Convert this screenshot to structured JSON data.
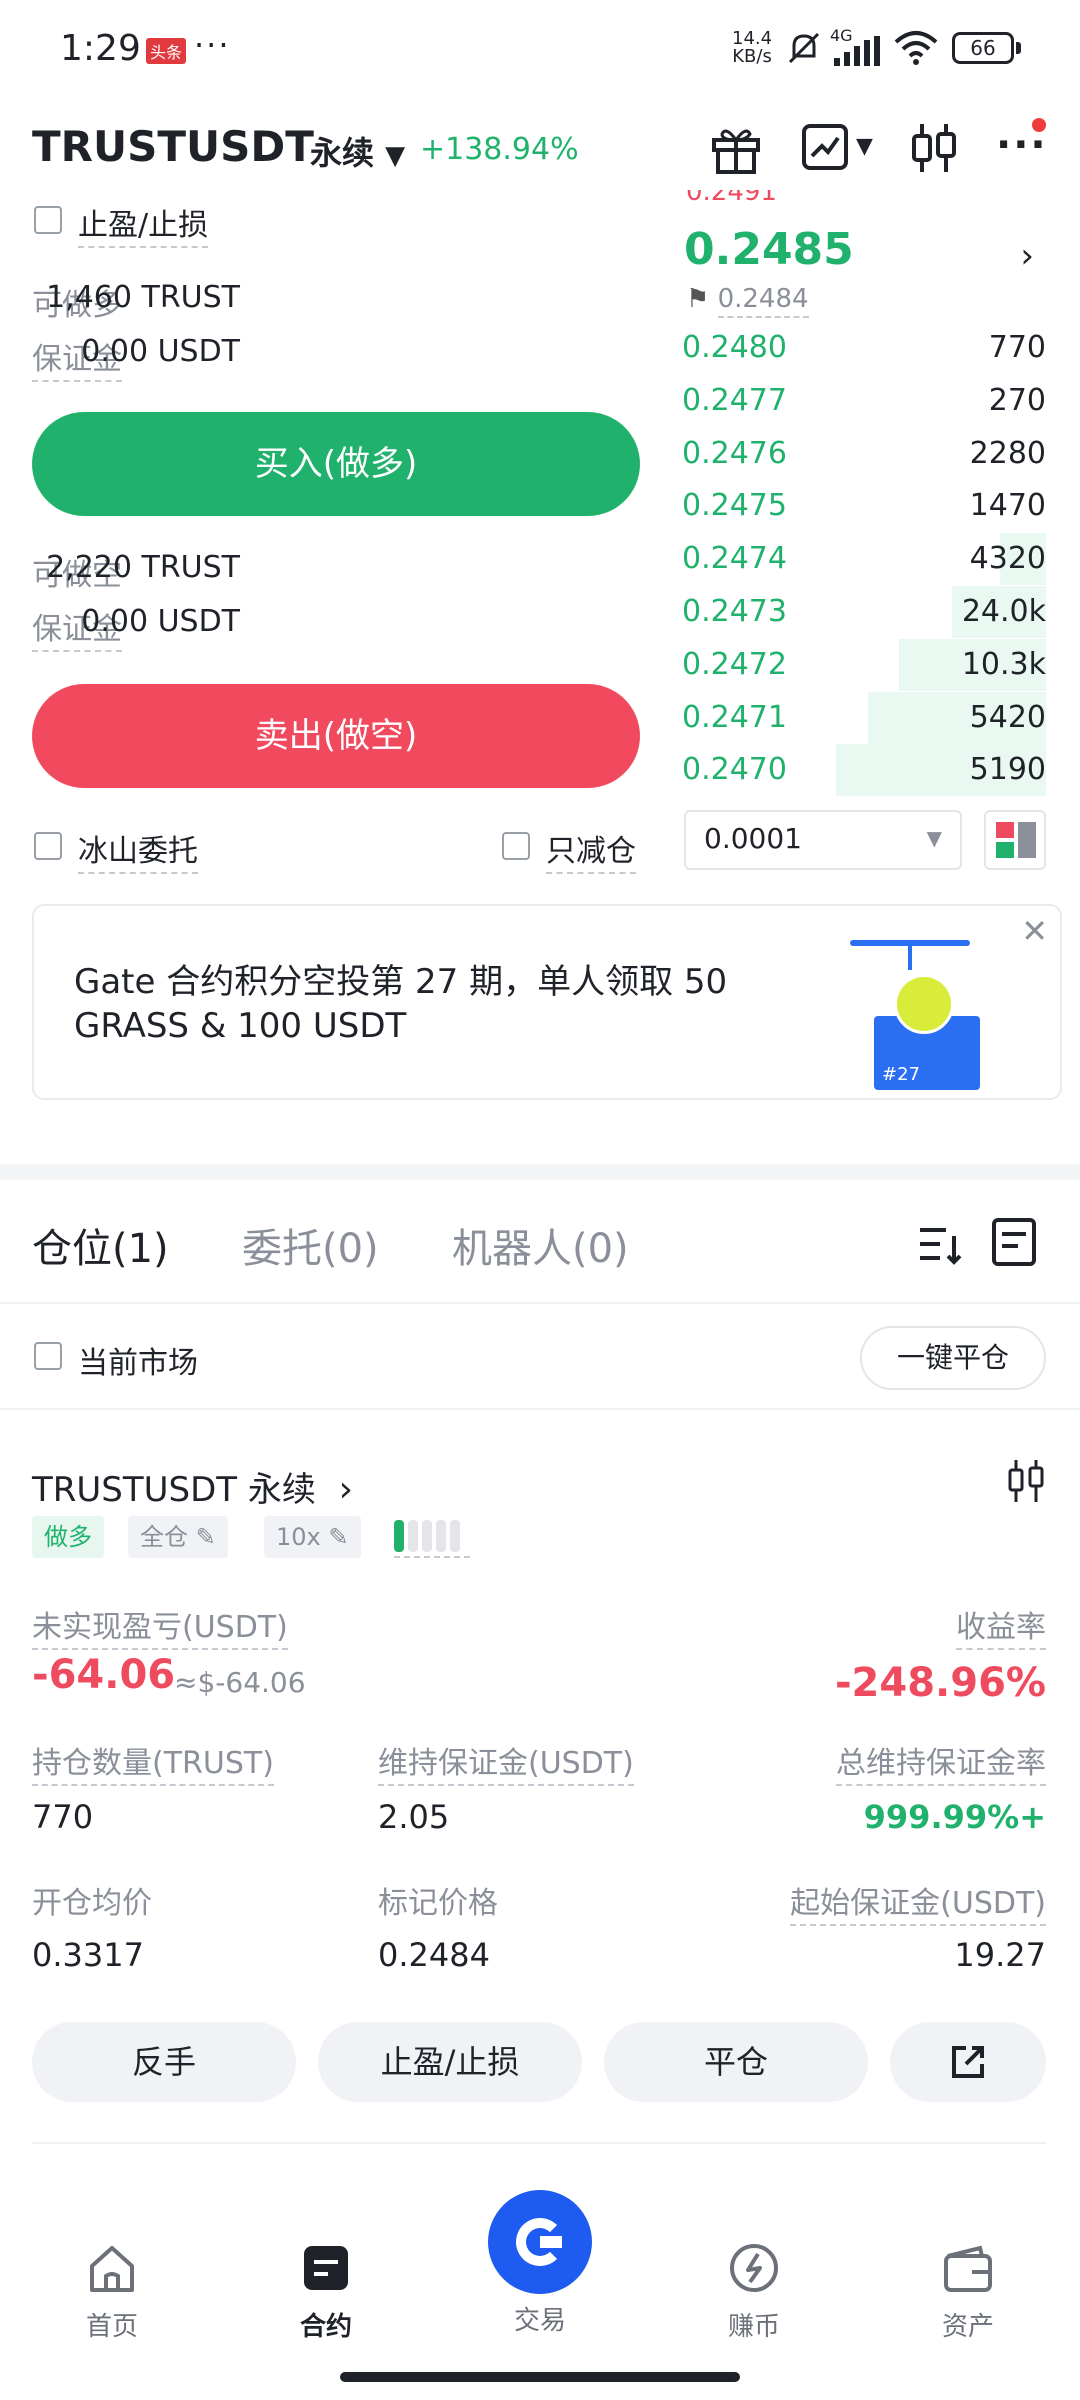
{
  "status_bar": {
    "time": "1:29",
    "app_badge": "头条",
    "more": "···",
    "net_speed_value": "14.4",
    "net_speed_unit": "KB/s",
    "signal_label": "4G",
    "battery": "66"
  },
  "header": {
    "pair": "TRUSTUSDT",
    "contract_type": "永续",
    "change": "+138.94%"
  },
  "order_panel": {
    "tp_sl_label": "止盈/止损",
    "long_available_label": "可做多",
    "long_available_value": "1,460 TRUST",
    "margin_label": "保证金",
    "long_margin_value": "0.00 USDT",
    "buy_button": "买入(做多)",
    "short_available_label": "可做空",
    "short_available_value": "2,220 TRUST",
    "short_margin_value": "0.00 USDT",
    "sell_button": "卖出(做空)",
    "iceberg_label": "冰山委托",
    "reduce_only_label": "只减仓"
  },
  "order_book": {
    "last_price": "0.2485",
    "mark_price": "0.2484",
    "bids": [
      {
        "price": "0.2480",
        "qty": "770",
        "depth": 0.0
      },
      {
        "price": "0.2477",
        "qty": "270",
        "depth": 0.0
      },
      {
        "price": "0.2476",
        "qty": "2280",
        "depth": 0.0
      },
      {
        "price": "0.2475",
        "qty": "1470",
        "depth": 0.0
      },
      {
        "price": "0.2474",
        "qty": "4320",
        "depth": 0.22
      },
      {
        "price": "0.2473",
        "qty": "24.0k",
        "depth": 0.45
      },
      {
        "price": "0.2472",
        "qty": "10.3k",
        "depth": 0.7
      },
      {
        "price": "0.2471",
        "qty": "5420",
        "depth": 0.85
      },
      {
        "price": "0.2470",
        "qty": "5190",
        "depth": 1.0
      }
    ],
    "precision": "0.0001"
  },
  "banner": {
    "text": "Gate 合约积分空投第 27 期，单人领取 50 GRASS & 100 USDT",
    "badge": "#27"
  },
  "tabs": {
    "positions": "仓位(1)",
    "orders": "委托(0)",
    "bots": "机器人(0)"
  },
  "filter": {
    "current_market_label": "当前市场",
    "close_all_button": "一键平仓"
  },
  "position": {
    "pair": "TRUSTUSDT 永续",
    "side_tag": "做多",
    "margin_mode_tag": "全仓",
    "leverage_tag": "10x",
    "unrealized_pnl_label": "未实现盈亏(USDT)",
    "unrealized_pnl_value": "-64.06",
    "unrealized_pnl_usd": "≈$-64.06",
    "roe_label": "收益率",
    "roe_value": "-248.96%",
    "size_label": "持仓数量(TRUST)",
    "size_value": "770",
    "maint_margin_label": "维持保证金(USDT)",
    "maint_margin_value": "2.05",
    "maint_margin_ratio_label": "总维持保证金率",
    "maint_margin_ratio_value": "999.99%+",
    "entry_price_label": "开仓均价",
    "entry_price_value": "0.3317",
    "mark_price_label": "标记价格",
    "mark_price_value": "0.2484",
    "initial_margin_label": "起始保证金(USDT)",
    "initial_margin_value": "19.27",
    "reverse_button": "反手",
    "tp_sl_button": "止盈/止损",
    "close_button": "平仓"
  },
  "bottom_nav": {
    "home": "首页",
    "futures": "合约",
    "trade": "交易",
    "earn": "赚币",
    "assets": "资产"
  },
  "colors": {
    "green": "#20b26c",
    "red": "#ef4b5f",
    "brand_blue": "#1e5bf0"
  }
}
